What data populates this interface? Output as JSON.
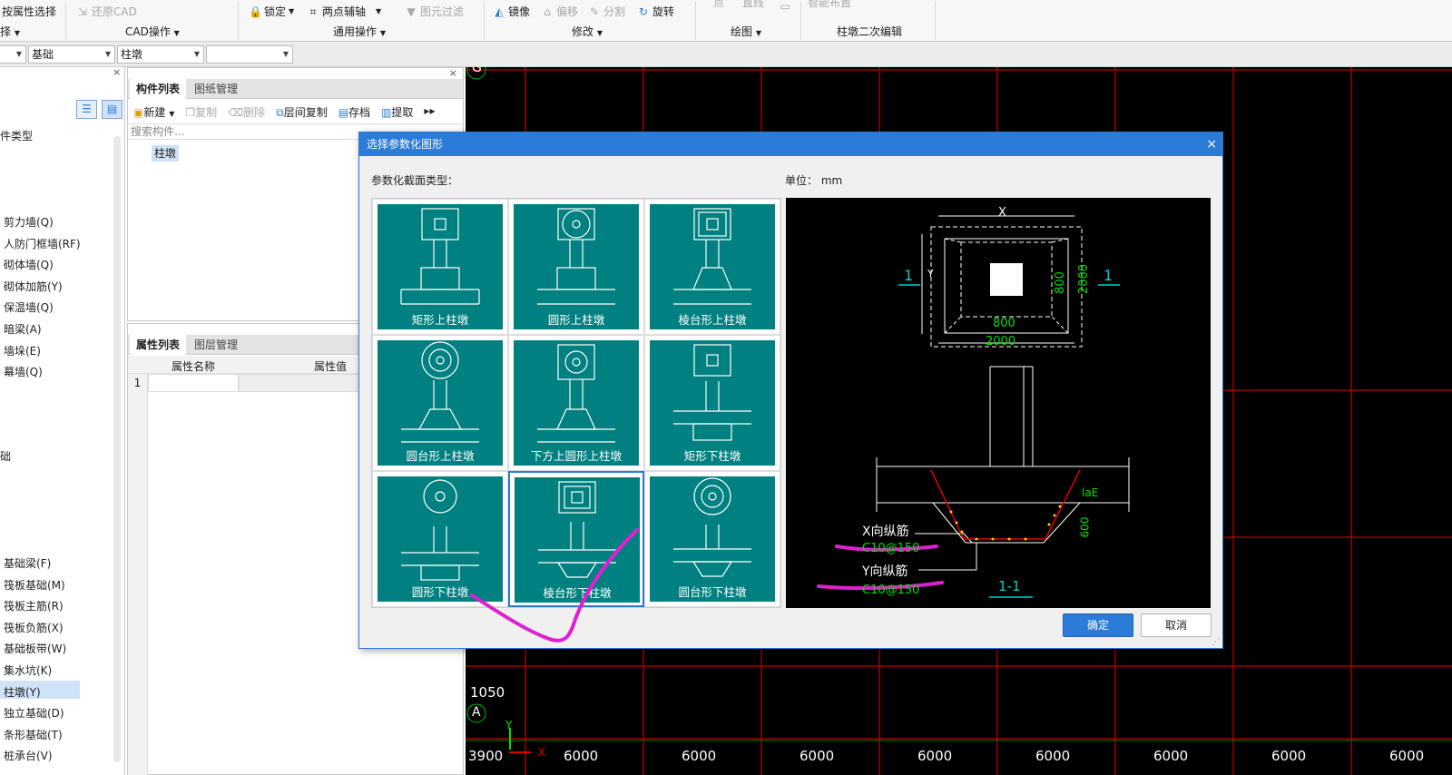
{
  "ribbon": {
    "select_by_attr": "按属性选择",
    "restore_cad": "还原CAD",
    "lock": "锁定",
    "two_point_aux": "两点辅轴",
    "element_filter": "图元过滤",
    "mirror": "镜像",
    "offset": "偏移",
    "split": "分割",
    "rotate": "旋转",
    "point": "点",
    "line": "直线",
    "smart_layout": "智能布置",
    "groups": {
      "select": "择",
      "cad_ops": "CAD操作",
      "common_ops": "通用操作",
      "modify": "修改",
      "draw": "绘图",
      "pier_edit": "柱墩二次编辑"
    }
  },
  "selectors": {
    "floor": "",
    "category": "基础",
    "type": "柱墩",
    "item": ""
  },
  "tree": {
    "header": "件类型",
    "items_top": [
      "剪力墙(Q)",
      "人防门框墙(RF)",
      "砌体墙(Q)",
      "砌体加筋(Y)",
      "保温墙(Q)",
      "暗梁(A)",
      "墙垛(E)",
      "幕墙(Q)"
    ],
    "mid_label": "础",
    "items_bottom": [
      "基础梁(F)",
      "筏板基础(M)",
      "筏板主筋(R)",
      "筏板负筋(X)",
      "基础板带(W)",
      "集水坑(K)",
      "柱墩(Y)",
      "独立基础(D)",
      "条形基础(T)",
      "桩承台(V)"
    ],
    "selected": "柱墩(Y)"
  },
  "component_panel": {
    "tab_list": "构件列表",
    "tab_drawing": "图纸管理",
    "new": "新建",
    "copy": "复制",
    "delete": "删除",
    "floor_copy": "层间复制",
    "save": "存档",
    "extract": "提取",
    "search_placeholder": "搜索构件...",
    "item": "柱墩"
  },
  "property_panel": {
    "tab_props": "属性列表",
    "tab_layers": "图层管理",
    "col_name": "属性名称",
    "col_value": "属性值",
    "row1": "1"
  },
  "cad": {
    "axis_g": "G",
    "axis_a": "A",
    "dim_1050": "1050",
    "dim_3900": "3900",
    "bottom_dims": [
      "6000",
      "6000",
      "6000",
      "6000",
      "6000",
      "6000",
      "6000",
      "6000"
    ],
    "x_axis": "X",
    "y_axis": "Y"
  },
  "dialog": {
    "title": "选择参数化图形",
    "close": "×",
    "section_type_label": "参数化截面类型：",
    "unit_label": "单位：  mm",
    "shapes": [
      "矩形上柱墩",
      "圆形上柱墩",
      "棱台形上柱墩",
      "圆台形上柱墩",
      "下方上圆形上柱墩",
      "矩形下柱墩",
      "圆形下柱墩",
      "棱台形下柱墩",
      "圆台形下柱墩"
    ],
    "selected_shape": "棱台形下柱墩",
    "ok": "确定",
    "cancel": "取消"
  },
  "preview": {
    "x": "X",
    "y": "Y",
    "section_mark_left": "1",
    "section_mark_right": "1",
    "dim_800_h": "800",
    "dim_2000_h": "2000",
    "dim_800_v": "800",
    "dim_2000_v": "2000",
    "lae": "laE",
    "dim_600": "600",
    "x_rebar": "X向纵筋",
    "x_rebar_spec": "C10@150",
    "y_rebar": "Y向纵筋",
    "y_rebar_spec": "C10@150",
    "section_title": "1-1"
  },
  "colors": {
    "teal": "#008080",
    "accent_blue": "#2b7bd8",
    "cad_grid_red": "#c00000",
    "dim_green": "#00e000",
    "annotation_magenta": "#e020d0"
  }
}
